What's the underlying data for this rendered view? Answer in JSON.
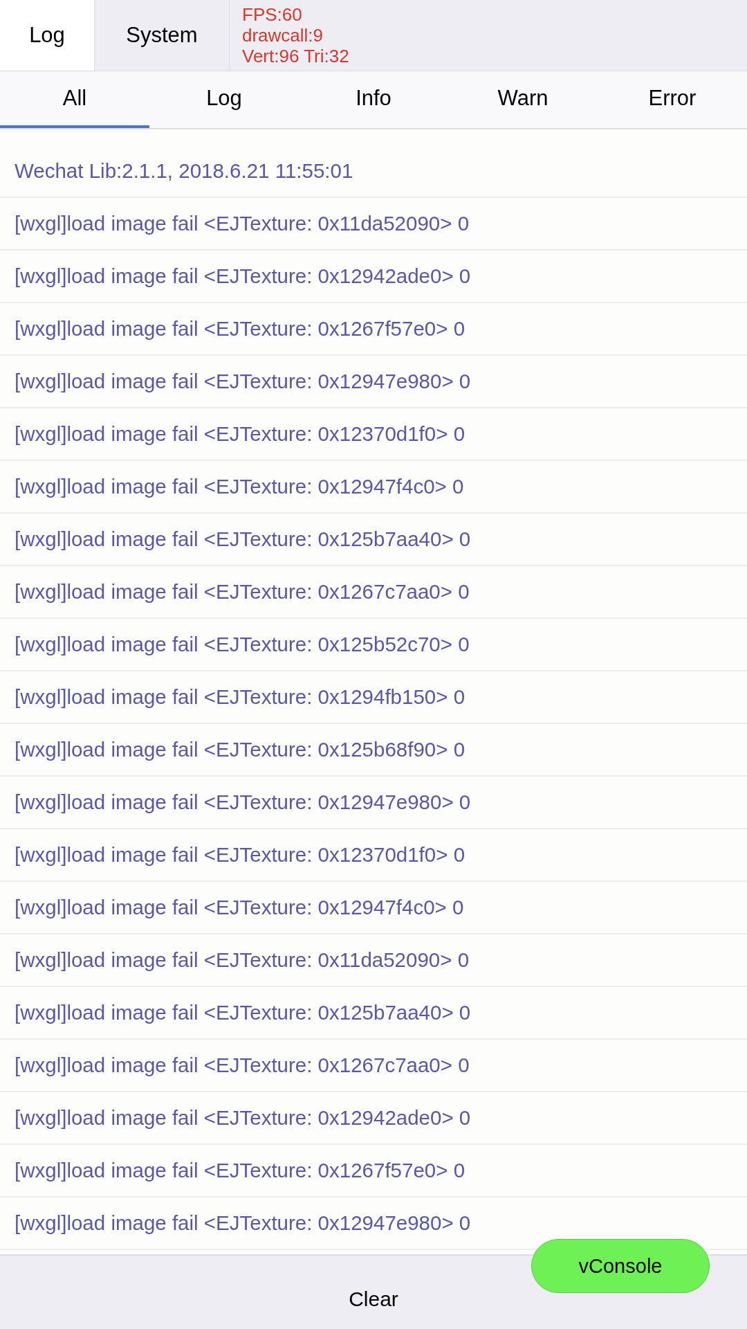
{
  "stats": [
    "FPS:60",
    "drawcall:9",
    "Vert:96 Tri:32"
  ],
  "top_tabs": [
    {
      "label": "Log",
      "selected": true
    },
    {
      "label": "System",
      "selected": false
    }
  ],
  "filter_tabs": [
    {
      "label": "All",
      "selected": true
    },
    {
      "label": "Log",
      "selected": false
    },
    {
      "label": "Info",
      "selected": false
    },
    {
      "label": "Warn",
      "selected": false
    },
    {
      "label": "Error",
      "selected": false
    }
  ],
  "log_rows": [
    "Wechat Lib:2.1.1, 2018.6.21 11:55:01",
    "[wxgl]load image fail <EJTexture: 0x11da52090> 0",
    "[wxgl]load image fail <EJTexture: 0x12942ade0> 0",
    "[wxgl]load image fail <EJTexture: 0x1267f57e0> 0",
    "[wxgl]load image fail <EJTexture: 0x12947e980> 0",
    "[wxgl]load image fail <EJTexture: 0x12370d1f0> 0",
    "[wxgl]load image fail <EJTexture: 0x12947f4c0> 0",
    "[wxgl]load image fail <EJTexture: 0x125b7aa40> 0",
    "[wxgl]load image fail <EJTexture: 0x1267c7aa0> 0",
    "[wxgl]load image fail <EJTexture: 0x125b52c70> 0",
    "[wxgl]load image fail <EJTexture: 0x1294fb150> 0",
    "[wxgl]load image fail <EJTexture: 0x125b68f90> 0",
    "[wxgl]load image fail <EJTexture: 0x12947e980> 0",
    "[wxgl]load image fail <EJTexture: 0x12370d1f0> 0",
    "[wxgl]load image fail <EJTexture: 0x12947f4c0> 0",
    "[wxgl]load image fail <EJTexture: 0x11da52090> 0",
    "[wxgl]load image fail <EJTexture: 0x125b7aa40> 0",
    "[wxgl]load image fail <EJTexture: 0x1267c7aa0> 0",
    "[wxgl]load image fail <EJTexture: 0x12942ade0> 0",
    "[wxgl]load image fail <EJTexture: 0x1267f57e0> 0",
    "[wxgl]load image fail <EJTexture: 0x12947e980> 0"
  ],
  "clear_button": "Clear",
  "float_button": "vConsole"
}
